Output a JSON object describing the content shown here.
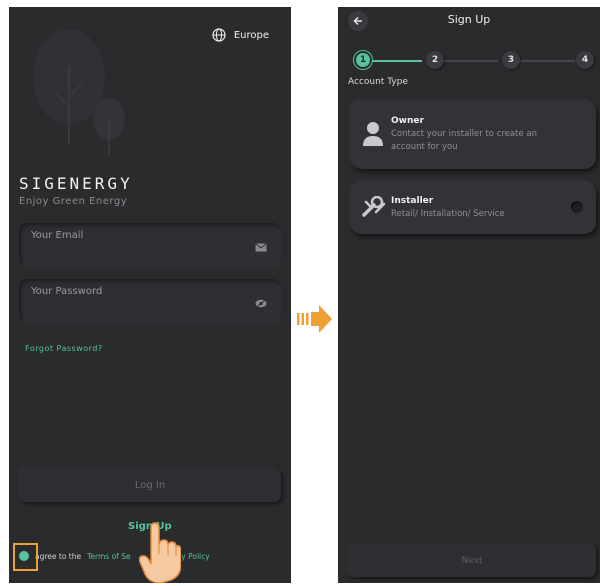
{
  "login": {
    "region_label": "Europe",
    "brand": "SIGENERGY",
    "tagline": "Enjoy Green Energy",
    "email_placeholder": "Your Email",
    "password_placeholder": "Your Password",
    "forgot_password": "Forgot Password?",
    "login_button": "Log In",
    "signup_link": "Sign Up",
    "agree_prefix": "agree to the",
    "terms_link": "Terms of Se",
    "privacy_link": "Privacy Policy"
  },
  "signup": {
    "title": "Sign Up",
    "steps": [
      "1",
      "2",
      "3",
      "4"
    ],
    "active_step": 1,
    "section_label": "Account Type",
    "options": [
      {
        "title": "Owner",
        "description_line1": "Contact your installer to create an",
        "description_line2": "account for you",
        "icon": "person-icon"
      },
      {
        "title": "Installer",
        "description_line1": "Retail/ Installation/ Service",
        "icon": "tools-icon"
      }
    ],
    "next_button": "Next"
  },
  "colors": {
    "accent": "#56c2a0",
    "background": "#2a2b2d",
    "highlight": "#f0a030"
  }
}
